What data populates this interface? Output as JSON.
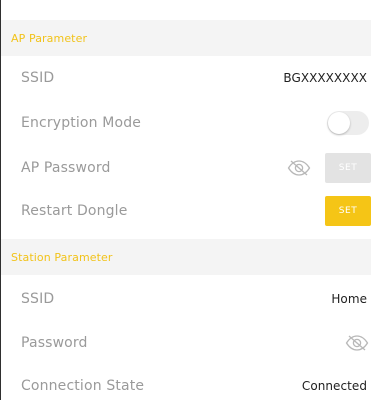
{
  "colors": {
    "section_header_text": "#f2c31a",
    "accent": "#f5c516",
    "disabled_button": "#e3e3e3"
  },
  "ap_section": {
    "title": "AP Parameter",
    "ssid_label": "SSID",
    "ssid_value": "BGXXXXXXXX",
    "encryption_label": "Encryption Mode",
    "encryption_enabled": false,
    "password_label": "AP Password",
    "password_set_label": "SET",
    "restart_label": "Restart Dongle",
    "restart_set_label": "SET"
  },
  "station_section": {
    "title": "Station Parameter",
    "ssid_label": "SSID",
    "ssid_value": "Home",
    "password_label": "Password",
    "connection_label": "Connection State",
    "connection_value": "Connected"
  },
  "icons": {
    "password_visibility": "eye-slash-icon"
  }
}
